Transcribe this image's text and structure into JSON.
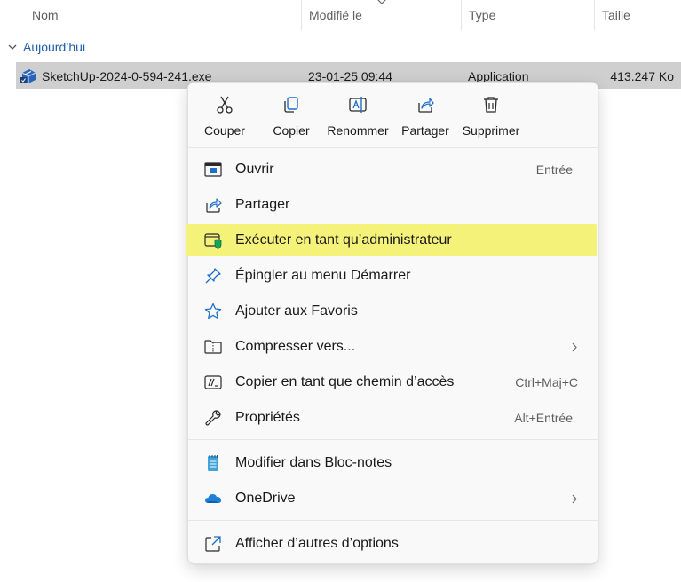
{
  "columns": {
    "name": "Nom",
    "modified": "Modifié le",
    "type": "Type",
    "size": "Taille"
  },
  "group": {
    "label": "Aujourd’hui"
  },
  "file": {
    "name": "SketchUp-2024-0-594-241.exe",
    "modified": "23-01-25 09:44",
    "type": "Application",
    "size": "413.247 Ko"
  },
  "context_menu": {
    "quick_actions": [
      {
        "label": "Couper",
        "icon": "scissors-icon"
      },
      {
        "label": "Copier",
        "icon": "copy-icon"
      },
      {
        "label": "Renommer",
        "icon": "rename-icon"
      },
      {
        "label": "Partager",
        "icon": "share-icon"
      },
      {
        "label": "Supprimer",
        "icon": "trash-icon"
      }
    ],
    "items": [
      {
        "label": "Ouvrir",
        "shortcut": "Entrée",
        "icon": "open-window-icon"
      },
      {
        "label": "Partager",
        "shortcut": "",
        "icon": "share-icon"
      },
      {
        "label": "Exécuter en tant qu’administrateur",
        "shortcut": "",
        "icon": "admin-shield-icon",
        "highlighted": true
      },
      {
        "label": "Épingler au menu Démarrer",
        "shortcut": "",
        "icon": "pin-icon"
      },
      {
        "label": "Ajouter aux Favoris",
        "shortcut": "",
        "icon": "star-icon"
      },
      {
        "label": "Compresser vers...",
        "shortcut": "",
        "icon": "zip-folder-icon",
        "submenu": true
      },
      {
        "label": "Copier en tant que chemin d’accès",
        "shortcut": "Ctrl+Maj+C",
        "icon": "copy-path-icon"
      },
      {
        "label": "Propriétés",
        "shortcut": "Alt+Entrée",
        "icon": "wrench-icon"
      }
    ],
    "secondary_items": [
      {
        "label": "Modifier dans Bloc-notes",
        "icon": "notepad-icon"
      },
      {
        "label": "OneDrive",
        "icon": "onedrive-cloud-icon",
        "submenu": true
      }
    ],
    "more_options": {
      "label": "Afficher d’autres d’options",
      "icon": "more-options-icon"
    }
  },
  "colors": {
    "highlight": "#f5f27a",
    "accent_blue": "#1f5ea8",
    "selection_bg": "#cfcfcf"
  }
}
